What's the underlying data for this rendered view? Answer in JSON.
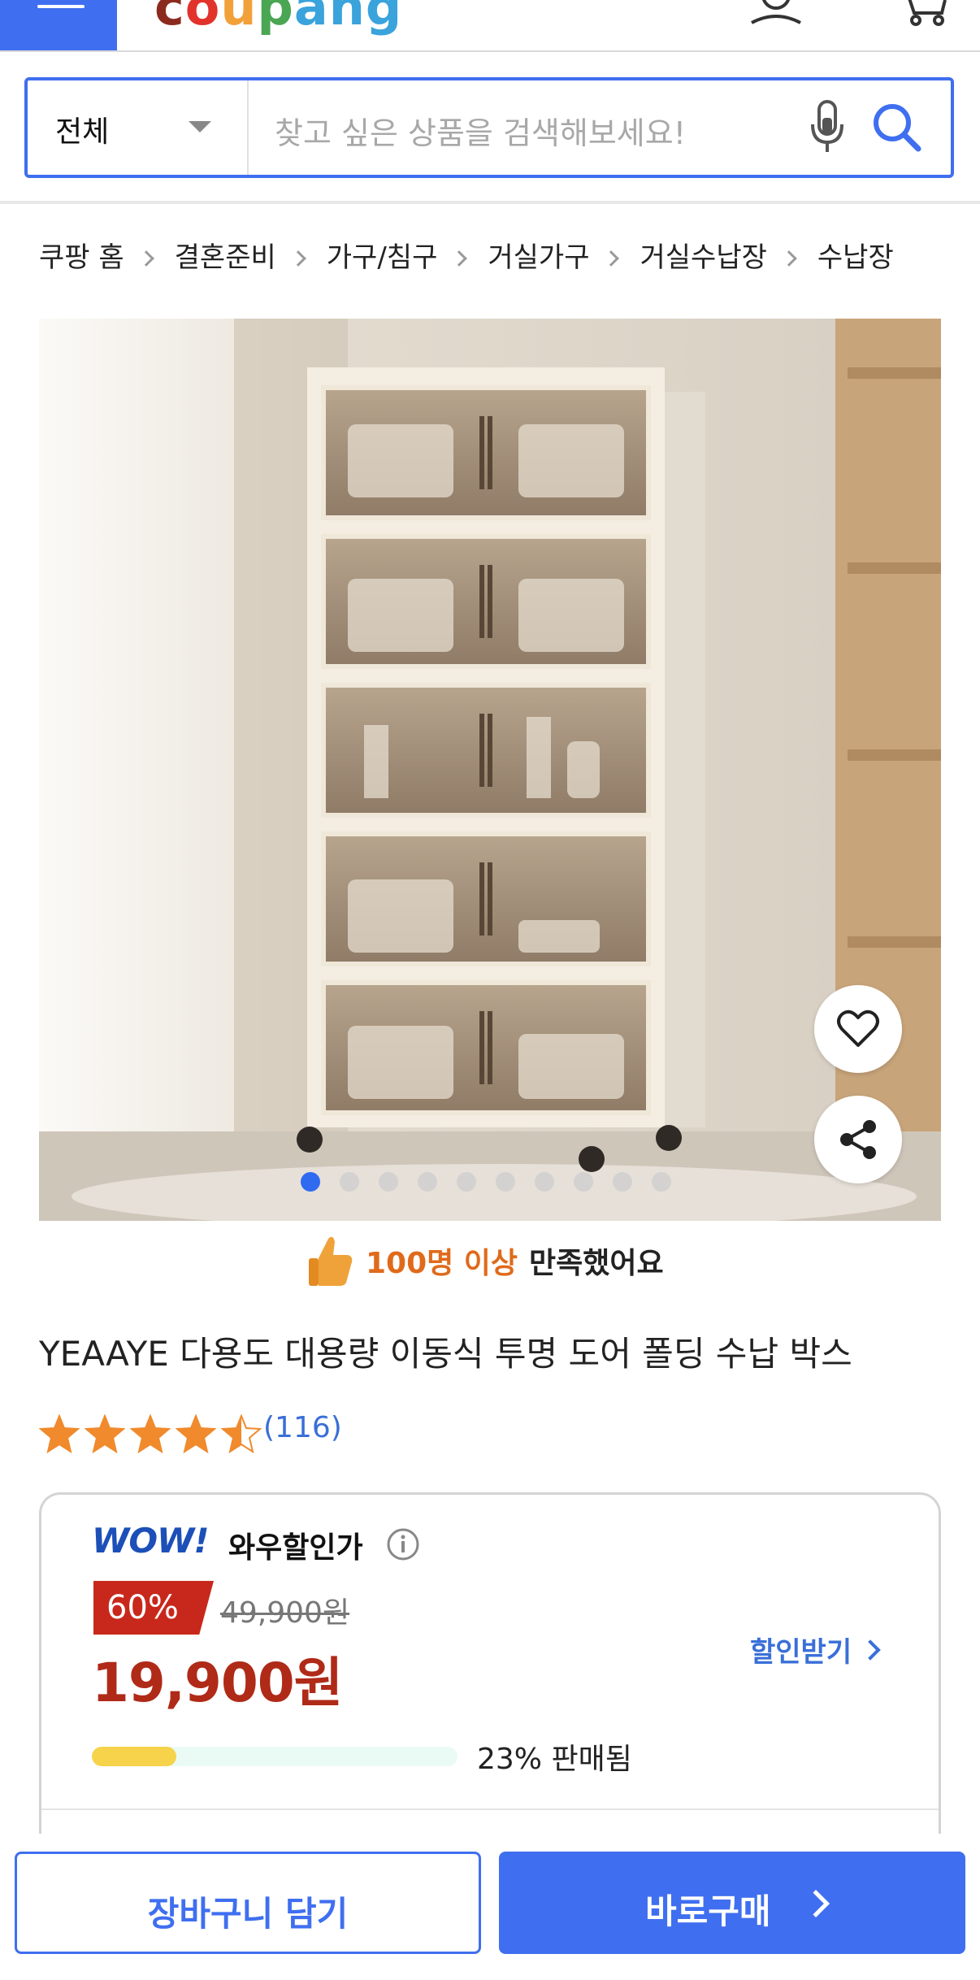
{
  "header": {
    "logo_text": "coupang",
    "menu_icon": "hamburger-menu-icon",
    "account_icon": "user-icon",
    "cart_icon": "cart-icon"
  },
  "search": {
    "category": "전체",
    "placeholder": "찾고 싶은 상품을 검색해보세요!",
    "mic_icon": "mic-icon",
    "search_icon": "search-icon"
  },
  "breadcrumb": [
    "쿠팡 홈",
    "결혼준비",
    "가구/침구",
    "거실가구",
    "거실수납장",
    "수납장"
  ],
  "gallery": {
    "image_count": 10,
    "active_index": 0,
    "wishlist_icon": "heart-icon",
    "share_icon": "share-icon"
  },
  "satisfaction": {
    "highlight": "100명 이상",
    "text": "만족했어요"
  },
  "product": {
    "title": "YEAAYE 다용도 대용량 이동식 투명 도어 폴딩 수납 박스",
    "rating": 4.5,
    "review_count": "(116)"
  },
  "price": {
    "wow_badge": "WOW!",
    "wow_label": "와우할인가",
    "discount": "60%",
    "original_price": "49,900원",
    "sale_price": "19,900원",
    "coupon_link": "할인받기",
    "sold_fraction": 0.23,
    "sold_text": "23% 판매됨"
  },
  "actions": {
    "add_to_cart": "장바구니 담기",
    "buy_now": "바로구매"
  },
  "colors": {
    "accent": "#3f6ff0",
    "price_red": "#b02a18",
    "badge_red": "#c8281c",
    "link_blue": "#3a6fd8",
    "progress_yellow": "#f6d34a"
  }
}
